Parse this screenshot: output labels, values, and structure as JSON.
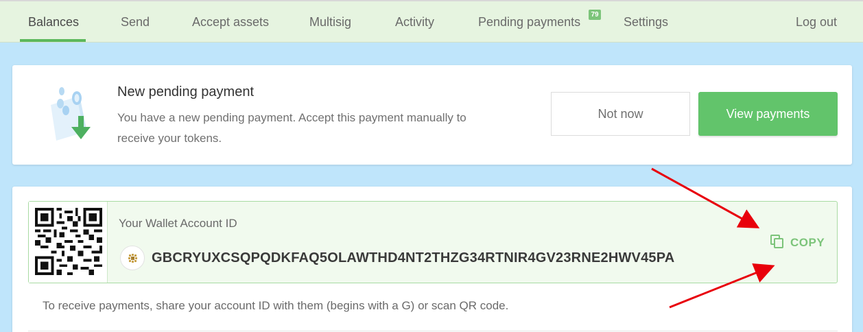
{
  "nav": {
    "items": [
      {
        "label": "Balances"
      },
      {
        "label": "Send"
      },
      {
        "label": "Accept assets"
      },
      {
        "label": "Multisig"
      },
      {
        "label": "Activity"
      },
      {
        "label": "Pending payments"
      },
      {
        "label": "Settings"
      }
    ],
    "pending_badge": "79",
    "logout_label": "Log out"
  },
  "notification": {
    "title": "New pending payment",
    "text": "You have a new pending payment. Accept this payment manually to receive your tokens.",
    "not_now_label": "Not now",
    "view_label": "View payments"
  },
  "wallet": {
    "account_label": "Your Wallet Account ID",
    "account_id": "GBCRYUXCSQPQDKFAQ5OLAWTHD4NT2THZG34RTNIR4GV23RNE2HWV45PA",
    "copy_label": "COPY",
    "hint": "To receive payments, share your account ID with them (begins with a G) or scan QR code."
  },
  "colors": {
    "accent": "#62c46b",
    "nav_bg": "#e6f4e0",
    "page_bg": "#bfe5fb",
    "annotation_arrows": "#e8000b"
  },
  "icons": [
    "pending-payment-illustration",
    "qr-code",
    "account-avatar-icon",
    "copy-icon",
    "annotation-arrow"
  ]
}
